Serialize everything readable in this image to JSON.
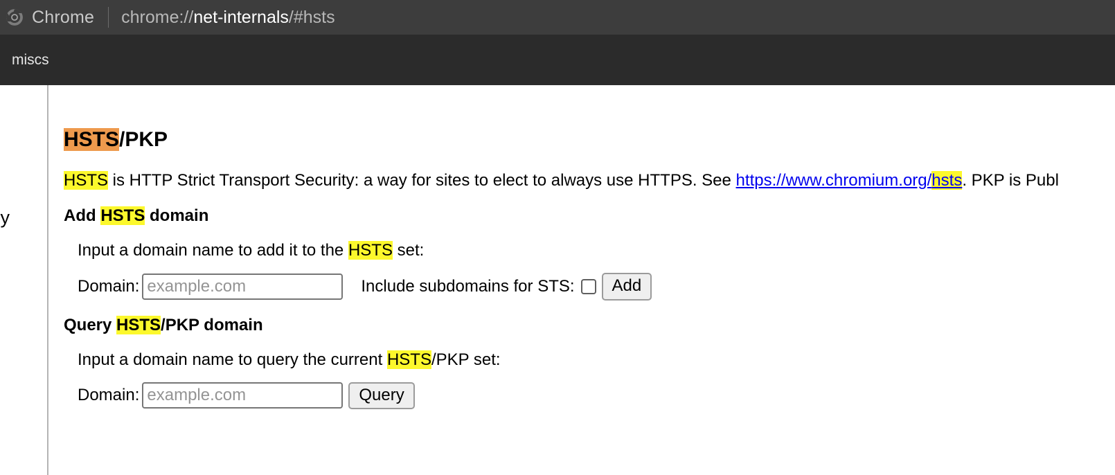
{
  "window": {
    "app_name": "Chrome",
    "url_prefix": "chrome://",
    "url_strong": "net-internals",
    "url_suffix": "/#hsts",
    "logo_icon": "chrome-logo-icon"
  },
  "tabs": [
    {
      "label": "miscs"
    }
  ],
  "sidebar": {
    "clipped_item_label": "olicy"
  },
  "main": {
    "heading": {
      "highlight": "HSTS",
      "rest": "/PKP"
    },
    "description": {
      "hl_1": "HSTS",
      "text_1": " is HTTP Strict Transport Security: a way for sites to elect to always use HTTPS. See ",
      "link_text_1": "https://www.chromium.org/",
      "link_hl": "hsts",
      "text_2": ". PKP is Publ"
    },
    "add_section": {
      "title_1": "Add ",
      "title_hl": "HSTS",
      "title_2": " domain",
      "hint_1": "Input a domain name to add it to the ",
      "hint_hl": "HSTS",
      "hint_2": " set:",
      "domain_label": "Domain:",
      "domain_value": "",
      "domain_placeholder": "example.com",
      "subdomains_label": "Include subdomains for STS:",
      "subdomains_checked": false,
      "add_button": "Add"
    },
    "query_section": {
      "title_1": "Query ",
      "title_hl": "HSTS",
      "title_2": "/PKP domain",
      "hint_1": "Input a domain name to query the current ",
      "hint_hl": "HSTS",
      "hint_2": "/PKP set:",
      "domain_label": "Domain:",
      "domain_value": "",
      "domain_placeholder": "example.com",
      "query_button": "Query"
    }
  },
  "colors": {
    "titlebar_bg": "#3d3d3d",
    "tabstrip_bg": "#2b2b2b",
    "highlight_yellow": "#fcf82c",
    "highlight_active_orange": "#ee9a4d",
    "link_blue": "#0000ee"
  }
}
